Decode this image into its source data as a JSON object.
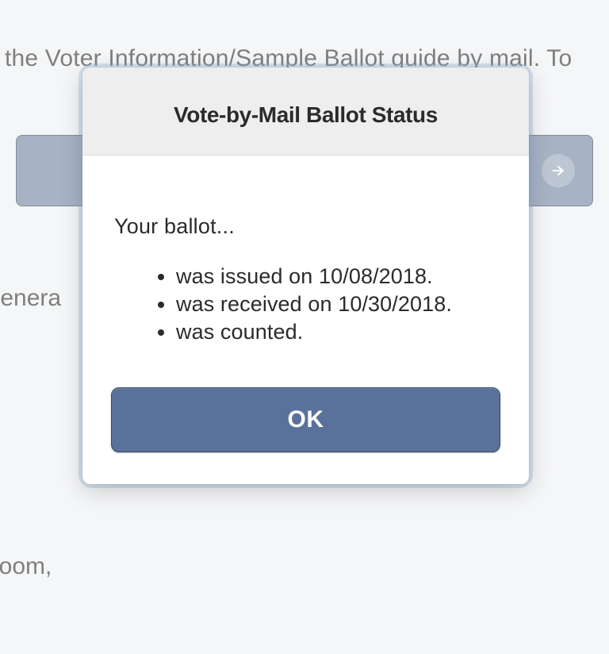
{
  "background": {
    "line1": "et the Voter Information/Sample Ballot guide by mail. To",
    "line2_punct": ".",
    "general": "Genera",
    "room": "Room,"
  },
  "bg_button": {
    "icon": "arrow-right-icon"
  },
  "modal": {
    "title": "Vote-by-Mail Ballot Status",
    "intro": "Your ballot...",
    "items": [
      "was issued on 10/08/2018.",
      "was received on 10/30/2018.",
      "was counted."
    ],
    "ok_label": "OK"
  }
}
